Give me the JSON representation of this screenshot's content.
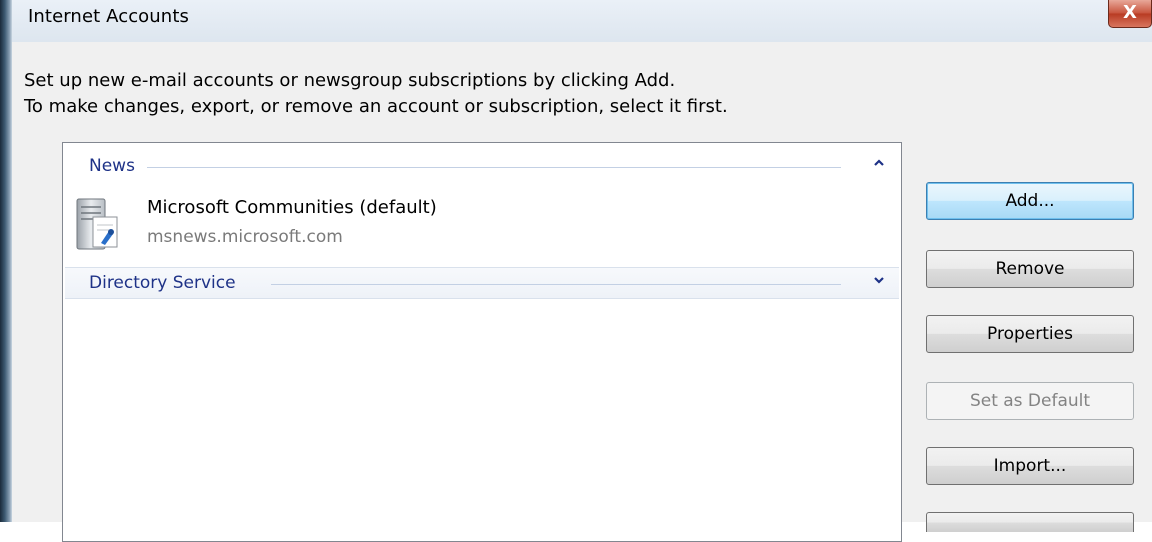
{
  "window": {
    "title": "Internet Accounts",
    "close_label": "X"
  },
  "instructions": {
    "line1": "Set up new e-mail accounts or newsgroup subscriptions by clicking Add.",
    "line2": "To make changes, export, or remove an account or subscription, select it first."
  },
  "account_list": {
    "groups": [
      {
        "label": "News",
        "state": "expanded",
        "items": [
          {
            "name": "Microsoft Communities (default)",
            "host": "msnews.microsoft.com",
            "icon": "news-server-icon"
          }
        ]
      },
      {
        "label": "Directory Service",
        "state": "collapsed",
        "items": []
      }
    ]
  },
  "buttons": {
    "add": "Add...",
    "remove": "Remove",
    "properties": "Properties",
    "set_default": "Set as Default",
    "import": "Import..."
  },
  "colors": {
    "group_header_text": "#1e3287",
    "default_button_border": "#3c7fb1",
    "close_button": "#c7523b"
  }
}
